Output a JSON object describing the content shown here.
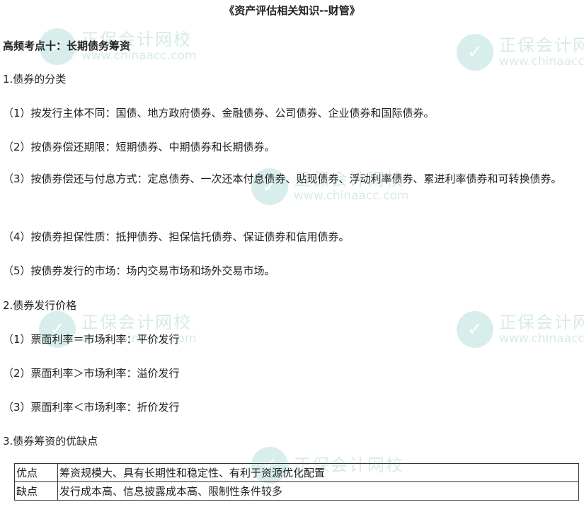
{
  "title": "《资产评估相关知识--财管》",
  "watermark": {
    "name": "正保会计网校",
    "url": "www.chinaacc.com"
  },
  "heading": "高频考点十：长期债务筹资",
  "section1": {
    "title": "1.债券的分类",
    "items": [
      "（1）按发行主体不同：国债、地方政府债券、金融债券、公司债券、企业债券和国际债券。",
      "（2）按债券偿还期限：短期债券、中期债券和长期债券。",
      "（3）按债券偿还与付息方式：定息债券、一次还本付息债券、贴现债券、浮动利率债券、累进利率债券和可转换债券。",
      "（4）按债券担保性质：抵押债券、担保信托债券、保证债券和信用债券。",
      "（5）按债券发行的市场：场内交易市场和场外交易市场。"
    ]
  },
  "section2": {
    "title": "2.债券发行价格",
    "items": [
      "（1）票面利率＝市场利率：平价发行",
      "（2）票面利率＞市场利率：溢价发行",
      "（3）票面利率＜市场利率：折价发行"
    ]
  },
  "section3": {
    "title": "3.债券筹资的优缺点",
    "table": [
      {
        "key": "优点",
        "value": "筹资规模大、具有长期性和稳定性、有利于资源优化配置"
      },
      {
        "key": "缺点",
        "value": "发行成本高、信息披露成本高、限制性条件较多"
      }
    ]
  }
}
